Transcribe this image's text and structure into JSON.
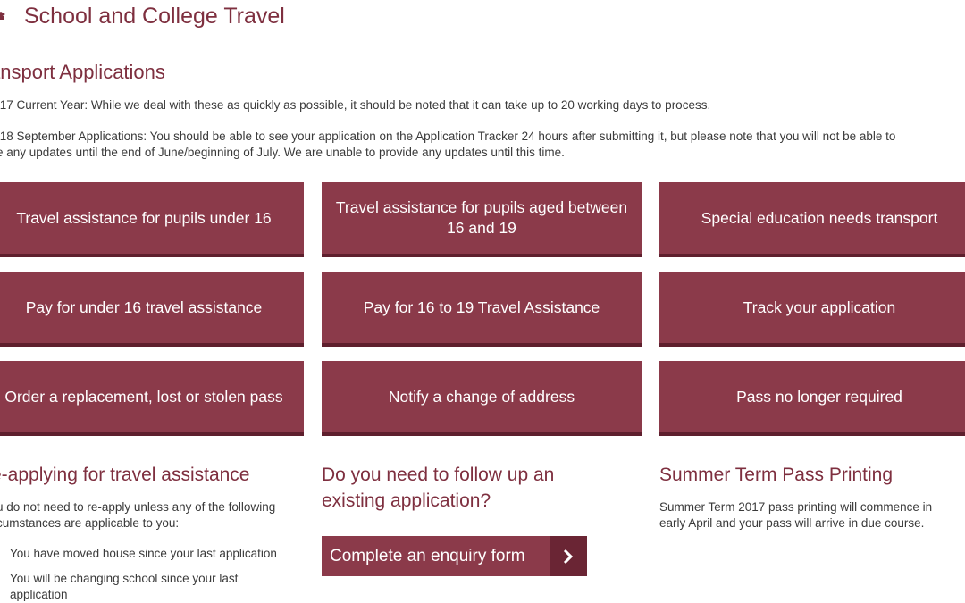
{
  "header": {
    "title": "School and College Travel",
    "icon": "graduation-cap-icon"
  },
  "applications": {
    "heading": "ansport Applications",
    "line1": "/17 Current Year: While we deal with these as quickly as possible, it should be noted that it can take up to 20 working days to process.",
    "line2a": "/18 September Applications: You should be able to see your application on the Application Tracker 24 hours after submitting it, but please note that you will not be able to",
    "line2b": "e any updates until the end of June/beginning of July.  We are unable to provide any updates until this time."
  },
  "tiles": [
    {
      "label": "Travel assistance for pupils under 16"
    },
    {
      "label": "Travel assistance for pupils aged between 16 and 19"
    },
    {
      "label": "Special education needs transport"
    },
    {
      "label": "Pay for under 16 travel assistance"
    },
    {
      "label": "Pay for 16 to 19 Travel Assistance"
    },
    {
      "label": "Track your application"
    },
    {
      "label": "Order a replacement, lost or stolen pass"
    },
    {
      "label": "Notify a change of address"
    },
    {
      "label": "Pass no longer required"
    }
  ],
  "reapply": {
    "heading": "e-applying for travel assistance",
    "intro_line1": "u do not need to re-apply unless any of the following",
    "intro_line2": "cumstances are applicable to you:",
    "items": [
      "You have moved house since your last application",
      "You will be changing school since your last application"
    ]
  },
  "followup": {
    "heading": "Do you need to follow up an existing application?",
    "button_label": "Complete an enquiry form",
    "button_icon": "chevron-right-icon"
  },
  "summer": {
    "heading": "Summer Term Pass Printing",
    "text": "Summer Term 2017 pass printing will commence in early April and your pass will arrive in due course."
  },
  "colors": {
    "brand": "#7e2f3f",
    "tile": "#8b3a4a",
    "tile_border": "#5e1f2d"
  }
}
